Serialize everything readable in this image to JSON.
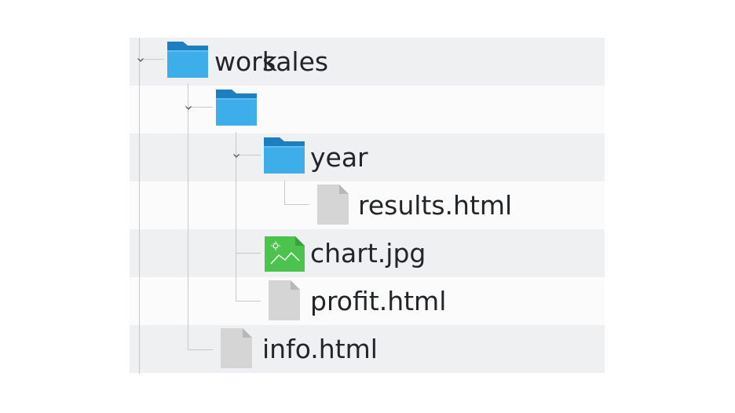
{
  "tree": {
    "items": [
      {
        "label": "work",
        "type": "folder",
        "expanded": true
      },
      {
        "label": "sales",
        "type": "folder",
        "expanded": true
      },
      {
        "label": "year",
        "type": "folder",
        "expanded": true
      },
      {
        "label": "results.html",
        "type": "file"
      },
      {
        "label": "chart.jpg",
        "type": "image"
      },
      {
        "label": "profit.html",
        "type": "file"
      },
      {
        "label": "info.html",
        "type": "file"
      }
    ]
  },
  "colors": {
    "row_alt": "#eff0f1",
    "row_base": "#fbfbfb",
    "folder_body": "#3daee9",
    "folder_tab": "#1d7fbf",
    "image_icon": "#4cc34c",
    "file_icon": "#d5d5d5",
    "text": "#232629",
    "tree_lines": "#c8c8c8"
  },
  "icons": {
    "folder": "folder-icon",
    "file": "file-icon",
    "image": "image-file-icon",
    "expander": "chevron-down-icon"
  }
}
